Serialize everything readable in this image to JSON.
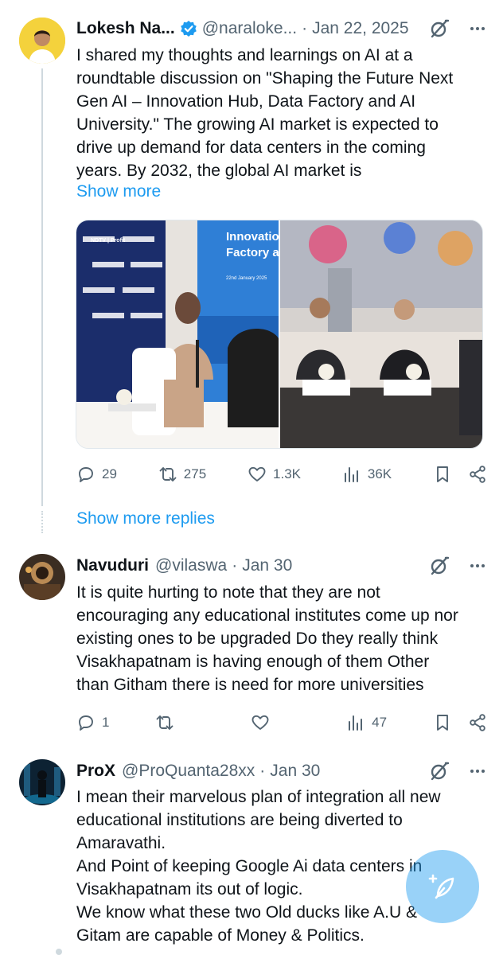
{
  "colors": {
    "accent": "#1d9bf0",
    "muted": "#536471",
    "text": "#0f1419",
    "verified": "#1d9bf0"
  },
  "tweet1": {
    "name": "Lokesh Na...",
    "handle": "@naraloke...",
    "sep": "·",
    "date": "Jan 22, 2025",
    "text": "I shared my thoughts and learnings on AI at a\nroundtable discussion on \"Shaping the Future Next\nGen AI – Innovation Hub, Data Factory and AI\nUniversity.\" The growing AI market is expected to\ndrive up demand for data centers in the coming\nyears. By 2032, the global AI market is",
    "show_more": "Show more",
    "media": {
      "left_brand": "NDTV | Profit",
      "left_banner_l1": "Innovation H",
      "left_banner_l2": "Factory and A",
      "left_banner_date": "22nd January 2025"
    },
    "stats": {
      "replies": "29",
      "reposts": "275",
      "likes": "1.3K",
      "views": "36K"
    }
  },
  "show_more_replies": "Show more replies",
  "tweet2": {
    "name": "Navuduri",
    "handle": "@vilaswa",
    "sep": "·",
    "date": "Jan 30",
    "text": "It is quite hurting to note that they are not\nencouraging any educational institutes come up nor\nexisting ones to be upgraded Do they really think\nVisakhapatnam is having enough of them  Other\nthan Githam there is need  for more universities",
    "stats": {
      "replies": "1",
      "reposts": "",
      "likes": "",
      "views": "47"
    }
  },
  "tweet3": {
    "name": "ProX",
    "handle": "@ProQuanta28xx",
    "sep": "·",
    "date": "Jan 30",
    "text": "I mean their marvelous  plan of integration  all new\neducational institutions are being diverted to\nAmaravathi.\nAnd Point of keeping Google Ai data centers in\nVisakhapatnam its out of logic.\nWe know what these two Old ducks like A.U &\nGitam are capable of Money  & Politics."
  },
  "icons": [
    "verified-badge-icon",
    "grok-icon",
    "more-icon",
    "reply-icon",
    "repost-icon",
    "like-icon",
    "views-icon",
    "bookmark-icon",
    "share-icon",
    "compose-icon"
  ]
}
